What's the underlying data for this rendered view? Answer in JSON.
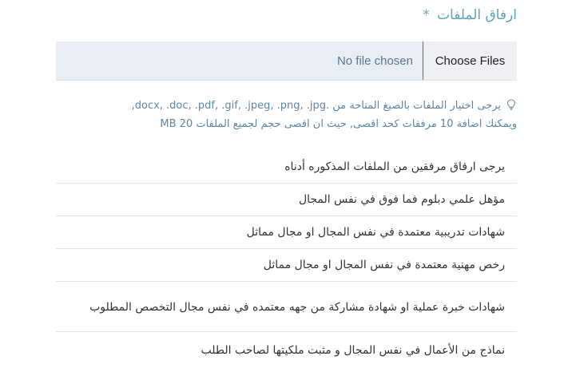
{
  "form": {
    "label": "ارفاق الملفات",
    "required_mark": "*"
  },
  "file_input": {
    "button_label": "Choose Files",
    "status_text": "No file chosen"
  },
  "hint": {
    "icon": "lightbulb-icon",
    "line1": "يرجى اختيار الملفات بالصيغ المتاحة من .docx, .doc, .pdf, .gif, .jpeg, .png, .jpg,",
    "line2": "ويمكنك اضافة 10 مرفقات كحد اقصى, حيث ان اقصى حجم لجميع الملفات MB 20"
  },
  "requirements": [
    "يرجى ارفاق مرفقين من الملفات المذكوره أدناه",
    "مؤهل علمي دبلوم فما فوق في نفس المجال",
    "شهادات تدريبية معتمدة في نفس المجال او مجال مماثل",
    "رخص مهنية معتمدة في نفس المجال او مجال مماثل",
    "شهادات خبرة عملية او شهادة مشاركة من جهه معتمده في نفس مجال التخصص المطلوب",
    "نماذج من الأعمال في نفس المجال و مثبت ملكيتها لصاحب الطلب"
  ],
  "colors": {
    "label": "#5aa6b8",
    "hint": "#5d86a6",
    "file_box": "#e9eef4"
  }
}
